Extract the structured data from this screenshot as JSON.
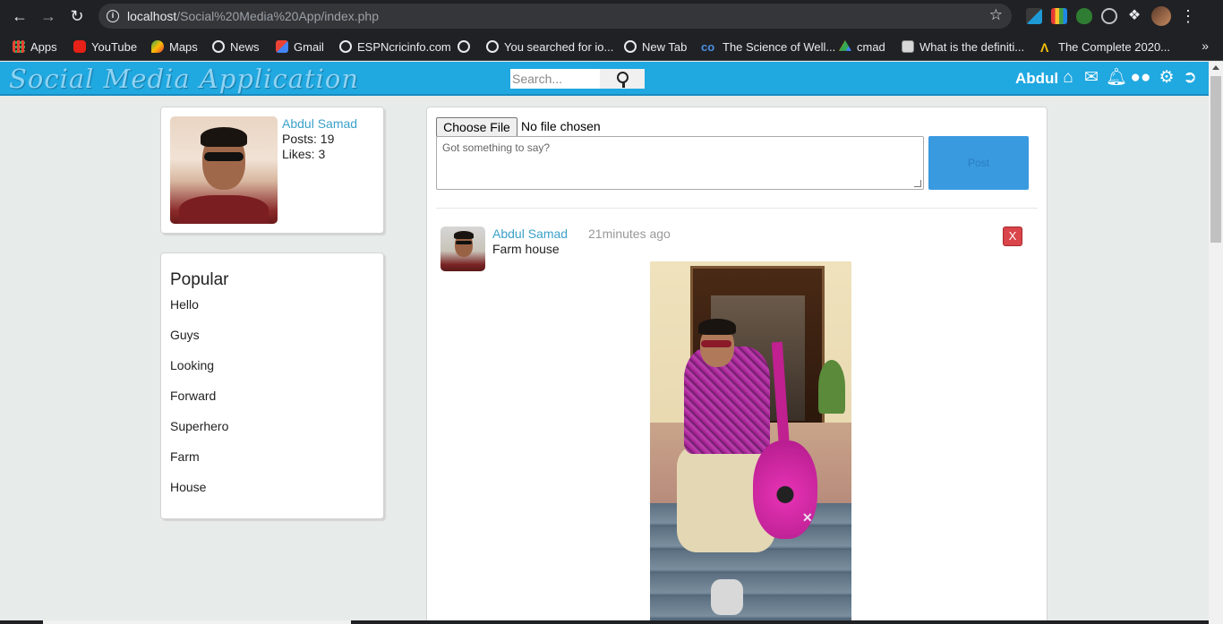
{
  "browser": {
    "url_host": "localhost",
    "url_path": "/Social%20Media%20App/index.php",
    "bookmarks": [
      {
        "label": "Apps",
        "icon": "apps-grid-icon"
      },
      {
        "label": "YouTube",
        "icon": "youtube-icon"
      },
      {
        "label": "Maps",
        "icon": "maps-icon"
      },
      {
        "label": "News",
        "icon": "globe-icon"
      },
      {
        "label": "Gmail",
        "icon": "gmail-icon"
      },
      {
        "label": "ESPNcricinfo.com",
        "icon": "globe-icon"
      },
      {
        "label": "",
        "icon": "globe-icon"
      },
      {
        "label": "You searched for io...",
        "icon": "globe-icon"
      },
      {
        "label": "New Tab",
        "icon": "globe-icon"
      },
      {
        "label": "The Science of Well...",
        "icon": "coursera-icon"
      },
      {
        "label": "cmad",
        "icon": "drive-icon"
      },
      {
        "label": "What is the definiti...",
        "icon": "page-icon"
      },
      {
        "label": "The Complete 2020...",
        "icon": "udemy-icon"
      }
    ],
    "more_label": "»"
  },
  "header": {
    "logo": "Social Media Application",
    "search_placeholder": "Search...",
    "username": "Abdul",
    "icons": [
      "home-icon",
      "envelope-icon",
      "bell-icon",
      "users-icon",
      "gear-icon",
      "sign-out-icon"
    ]
  },
  "profile": {
    "name": "Abdul Samad",
    "posts": "Posts: 19",
    "likes": "Likes: 3"
  },
  "popular": {
    "title": "Popular",
    "items": [
      "Hello",
      "Guys",
      "Looking",
      "Forward",
      "Superhero",
      "Farm",
      "House"
    ]
  },
  "composer": {
    "file_button": "Choose File",
    "file_status": "No file chosen",
    "placeholder": "Got something to say?",
    "post_button": "Post"
  },
  "post": {
    "author": "Abdul Samad",
    "time": "21minutes ago",
    "body": "Farm house",
    "delete_label": "X"
  },
  "colors": {
    "header_bg": "#20a8e0",
    "link": "#3aa0c8",
    "post_button": "#3a9ae0",
    "delete_button": "#d9454a",
    "page_bg": "#e7ecea"
  }
}
